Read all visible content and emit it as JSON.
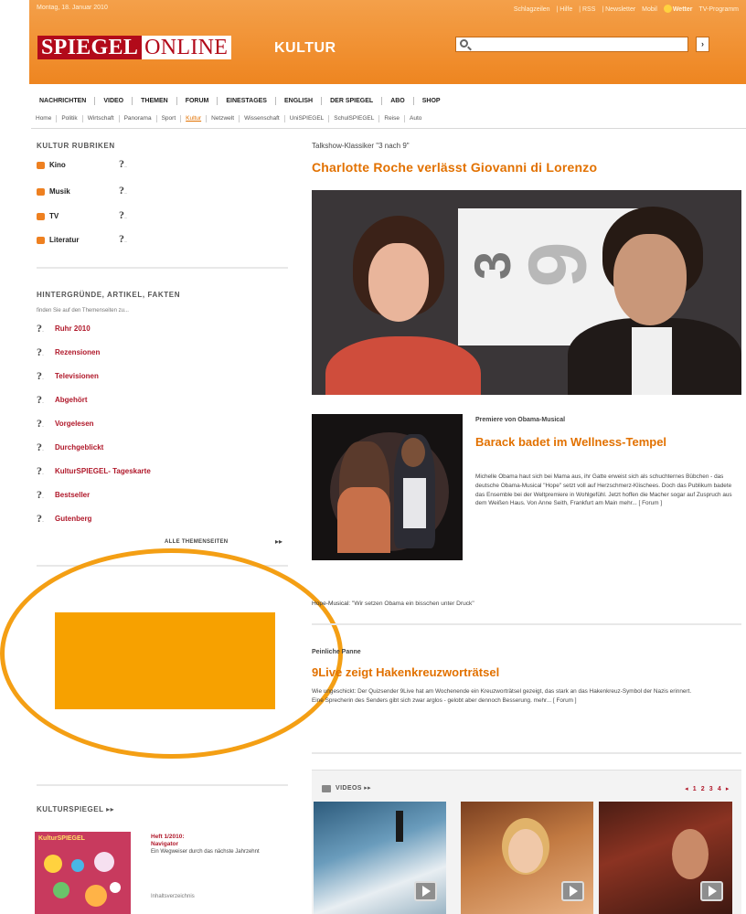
{
  "header": {
    "date": "Montag, 18. Januar 2010",
    "top_links": [
      "Schlagzeilen",
      "| Hilfe",
      "| RSS",
      "| Newsletter",
      "Mobil",
      "Wetter",
      "TV-Programm"
    ],
    "logo_spiegel": "SPIEGEL",
    "logo_online": "ONLINE",
    "section": "KULTUR",
    "search": {
      "value": "",
      "button": "›"
    }
  },
  "nav": {
    "main": [
      "NACHRICHTEN",
      "VIDEO",
      "THEMEN",
      "FORUM",
      "EINESTAGES",
      "ENGLISH",
      "DER SPIEGEL",
      "ABO",
      "SHOP"
    ],
    "sub": [
      "Home",
      "Politik",
      "Wirtschaft",
      "Panorama",
      "Sport",
      "Kultur",
      "Netzwelt",
      "Wissenschaft",
      "UniSPIEGEL",
      "SchulSPIEGEL",
      "Reise",
      "Auto"
    ],
    "active_sub": "Kultur"
  },
  "sidebar": {
    "rubriken_title": "KULTUR RUBRIKEN",
    "rubriken": [
      "Kino",
      "Musik",
      "TV",
      "Literatur"
    ],
    "hintergruende_title": "HINTERGRÜNDE, ARTIKEL, FAKTEN",
    "hintergruende_sub": "finden Sie auf den Themenseiten zu...",
    "topics": [
      "Ruhr 2010",
      "Rezensionen",
      "Televisionen",
      "Abgehört",
      "Vorgelesen",
      "Durchgeblickt",
      "KulturSPIEGEL- Tageskarte",
      "Bestseller",
      "Gutenberg"
    ],
    "all_topics": "ALLE THEMENSEITEN",
    "all_topics_arrow": "▸▸",
    "kulturspiegel_title": "KULTURSPIEGEL",
    "kulturspiegel_arrow": "▸▸",
    "cover_label": "KulturSPIEGEL",
    "issue_title_1": "Heft 1/2010:",
    "issue_title_2": "Navigator",
    "issue_desc": "Ein Wegweiser durch das nächste Jahrzehnt",
    "issue_toc": "Inhaltsverzeichnis"
  },
  "lead": {
    "kicker": "Talkshow-Klassiker \"3 nach 9\"",
    "headline": "Charlotte Roche verlässt Giovanni di Lorenzo"
  },
  "obama": {
    "kicker": "Premiere von Obama-Musical",
    "headline": "Barack badet im Wellness-Tempel",
    "body": "Michelle Obama haut sich bei Mama aus, ihr Gatte erweist sich als schuchternes Bübchen - das deutsche Obama-Musical \"Hope\" setzt voll auf Herzschmerz-Klischees. Doch das Publikum badete das Ensemble bei der Weltpremiere in Wohlgefühl. Jetzt hoffen die Macher sogar auf Zuspruch aus dem Weißen Haus. Von Anne Seith, Frankfurt am Main mehr... [ Forum ]",
    "related_label": "Hope-Musical:",
    "related_text": "\"Wir setzen Obama ein bisschen unter Druck\""
  },
  "panne": {
    "kicker": "Peinliche Panne",
    "headline": "9Live zeigt Hakenkreuzworträtsel",
    "body": "Wie ungeschickt: Der Quizsender 9Live hat am Wochenende ein Kreuzworträtsel gezeigt, das stark an das Hakenkreuz-Symbol der Nazis erinnert. Eine Sprecherin des Senders gibt sich zwar arglos - gelobt aber dennoch Besserung. mehr... [ Forum ]"
  },
  "videos": {
    "title": "VIDEOS ▸▸",
    "pager": "◂ 1 2 3 4 ▸"
  },
  "colors": {
    "brand_orange": "#ee8520",
    "headline_orange": "#e27100",
    "spiegel_red": "#b20a1a",
    "highlight": "#f49f14",
    "ad_fill": "#f7a100"
  }
}
